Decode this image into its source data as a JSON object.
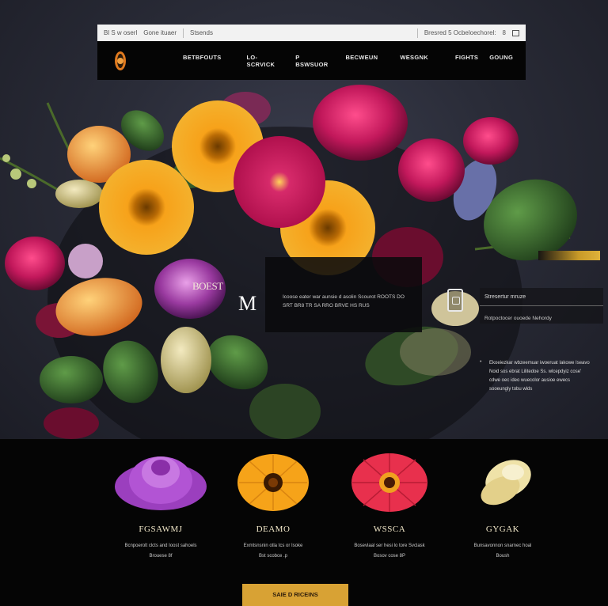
{
  "browser": {
    "url_left": "Bl S  w oserl",
    "url_mid": "Gone ituaer",
    "url_tab": "Stsends",
    "url_right": "Bresred 5 Ocbeloechorel:",
    "url_num": "8"
  },
  "nav": {
    "items": [
      "BETBFOUTS",
      "LO- SCRVICK",
      "P BSWSUOR",
      "BECWEUN",
      "WESGNK",
      "FIGHTS",
      "GOUNG"
    ]
  },
  "hero": {
    "best_label": "BOEST",
    "big_letter": "M",
    "card_text": "Icoose eater war aunsie d asolin Scourot ROOTS DO SRT BR8 TR SA RRO BRVE HS RUS",
    "panel_title": "Stresertur mruze",
    "panel_sub": "Rotpoctocer ouoede Nehordy",
    "paragraph": "Ekoeiezkar wbzeemuar iwoeruat Iakowe Iseavo Noid sos ebrat Lilitedoe Ss. wlcepdyiz cose' cdwe oec ideo wuecolor ausioe ewecs sooeungly tobu wlds"
  },
  "products": [
    {
      "name": "FGSAWMJ",
      "desc1": "Bcnpoerolt clcts and Ioost sahoels",
      "desc2": "Brouese 8f"
    },
    {
      "name": "DEAMO",
      "desc1": "Exmtsnsnin otla tcs or Isoke",
      "desc2": "Bst scobce .p"
    },
    {
      "name": "WSSCA",
      "desc1": "Bosevlaal ser hesi lo tore Svclask",
      "desc2": "Bosov cose 8P"
    },
    {
      "name": "GYGAK",
      "desc1": "Bunsavonnon snarnec hoal",
      "desc2": "Boush"
    }
  ],
  "cta": {
    "label": "SAIE D RICEINS"
  },
  "colors": {
    "accent": "#d8a234",
    "bottom_bg": "#050505"
  }
}
